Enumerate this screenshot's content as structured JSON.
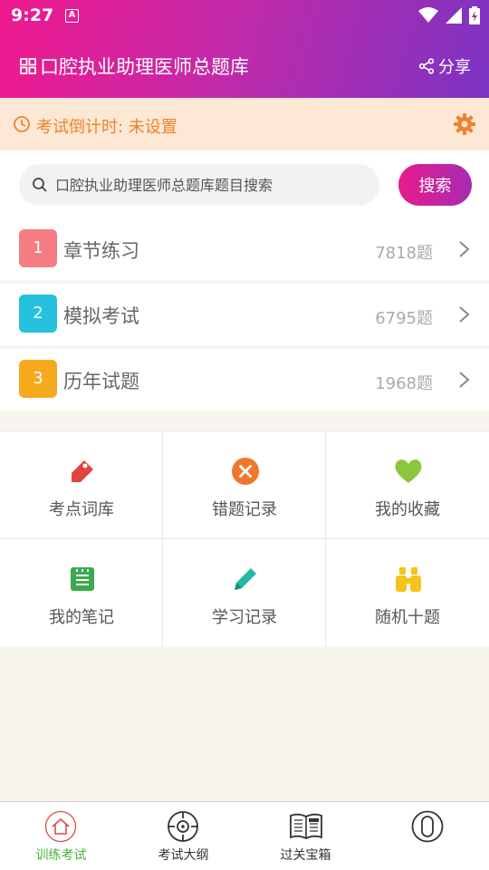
{
  "status_bar": {
    "time": "9:27",
    "app_icon_letter": "A"
  },
  "header": {
    "title": "口腔执业助理医师总题库",
    "share_label": "分享"
  },
  "countdown": {
    "label": "考试倒计时: 未设置"
  },
  "search": {
    "placeholder": "口腔执业助理医师总题库题目搜索",
    "button_label": "搜索"
  },
  "categories": [
    {
      "number": "1",
      "name": "章节练习",
      "count": "7818题",
      "color": "#f57c83"
    },
    {
      "number": "2",
      "name": "模拟考试",
      "count": "6795题",
      "color": "#26c1dc"
    },
    {
      "number": "3",
      "name": "历年试题",
      "count": "1968题",
      "color": "#f7a91e"
    }
  ],
  "tools": [
    {
      "label": "考点词库",
      "icon": "tag-icon",
      "color": "#e0443e"
    },
    {
      "label": "错题记录",
      "icon": "close-circle-icon",
      "color": "#f0762b"
    },
    {
      "label": "我的收藏",
      "icon": "heart-icon",
      "color": "#8cc63e"
    },
    {
      "label": "我的笔记",
      "icon": "notebook-icon",
      "color": "#3aaa4c"
    },
    {
      "label": "学习记录",
      "icon": "pencil-icon",
      "color": "#26b8a6"
    },
    {
      "label": "随机十题",
      "icon": "binoculars-icon",
      "color": "#f5c31c"
    }
  ],
  "bottom_nav": [
    {
      "label": "训练考试",
      "icon": "home-icon",
      "active": true
    },
    {
      "label": "考试大纲",
      "icon": "target-icon",
      "active": false
    },
    {
      "label": "过关宝箱",
      "icon": "book-icon",
      "active": false
    },
    {
      "label": "",
      "icon": "profile-icon",
      "active": false
    }
  ],
  "colors": {
    "accent_pink": "#e81c8c",
    "accent_purple": "#7b33c2",
    "active_green": "#4caf3e",
    "countdown_orange": "#f0822b"
  }
}
